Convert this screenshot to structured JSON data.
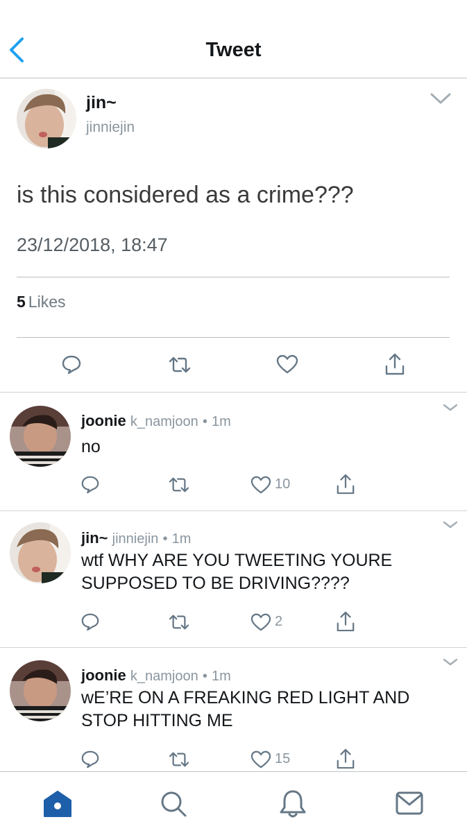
{
  "header": {
    "title": "Tweet"
  },
  "main_tweet": {
    "name": "jin~",
    "handle": "jinniejin",
    "text": "is this considered as a crime???",
    "timestamp": "23/12/2018, 18:47",
    "likes_count": "5",
    "likes_label": "Likes"
  },
  "replies": [
    {
      "name": "joonie",
      "handle": "k_namjoon",
      "time": "1m",
      "text": "no",
      "like_count": "10"
    },
    {
      "name": "jin~",
      "handle": "jinniejin",
      "time": "1m",
      "text": "wtf WHY ARE YOU TWEETING YOURE SUPPOSED TO BE DRIVING????",
      "like_count": "2"
    },
    {
      "name": "joonie",
      "handle": "k_namjoon",
      "time": "1m",
      "text": "wE’RE ON A FREAKING RED LIGHT AND STOP HITTING ME",
      "like_count": "15"
    }
  ],
  "separator": "•",
  "colors": {
    "accent": "#1da1f2",
    "home_active": "#1d5fa8",
    "icon_gray": "#657786",
    "text": "#14171a"
  },
  "icons": [
    "back-chevron-icon",
    "chevron-down-icon",
    "reply-icon",
    "retweet-icon",
    "like-icon",
    "share-icon",
    "home-icon",
    "search-icon",
    "notifications-icon",
    "messages-icon"
  ]
}
